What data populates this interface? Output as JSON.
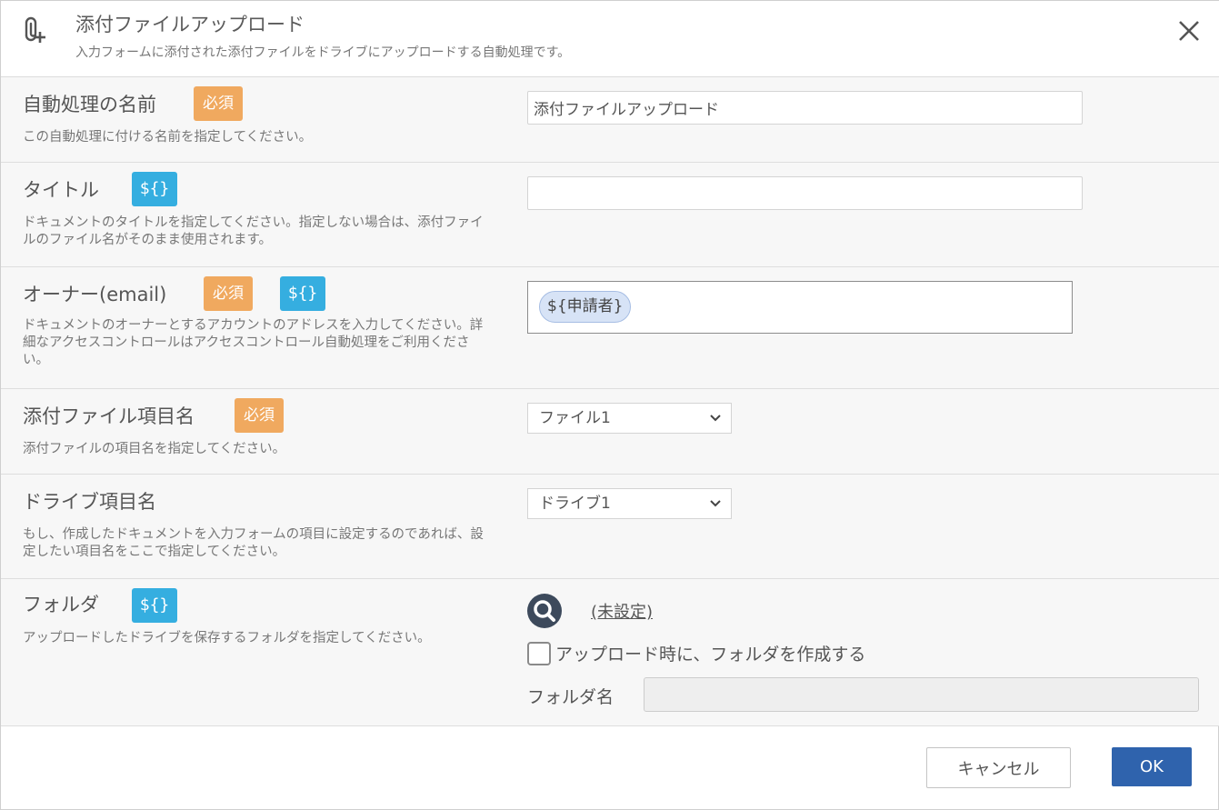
{
  "header": {
    "title": "添付ファイルアップロード",
    "subtitle": "入力フォームに添付された添付ファイルをドライブにアップロードする自動処理です。",
    "icon": "paperclip-plus-icon",
    "close_icon": "close-icon"
  },
  "badges": {
    "required": "必須",
    "variable": "${}"
  },
  "fields": {
    "name": {
      "label": "自動処理の名前",
      "description": "この自動処理に付ける名前を指定してください。",
      "value": "添付ファイルアップロード"
    },
    "title": {
      "label": "タイトル",
      "description": "ドキュメントのタイトルを指定してください。指定しない場合は、添付ファイルのファイル名がそのまま使用されます。",
      "value": ""
    },
    "owner": {
      "label": "オーナー(email)",
      "description": "ドキュメントのオーナーとするアカウントのアドレスを入力してください。詳細なアクセスコントロールはアクセスコントロール自動処理をご利用ください。",
      "chip": "${申請者}"
    },
    "attachment": {
      "label": "添付ファイル項目名",
      "description": "添付ファイルの項目名を指定してください。",
      "selected": "ファイル1"
    },
    "drive": {
      "label": "ドライブ項目名",
      "description": "もし、作成したドキュメントを入力フォームの項目に設定するのであれば、設定したい項目名をここで指定してください。",
      "selected": "ドライブ1"
    },
    "folder": {
      "label": "フォルダ",
      "description": "アップロードしたドライブを保存するフォルダを指定してください。",
      "unset_link": "(未設定)",
      "create_checkbox_label": "アップロード時に、フォルダを作成する",
      "create_checked": false,
      "folder_name_label": "フォルダ名",
      "folder_name_value": ""
    }
  },
  "footer": {
    "cancel_label": "キャンセル",
    "ok_label": "OK"
  },
  "colors": {
    "required_badge": "#f0a95f",
    "variable_badge": "#35aee0",
    "ok_button": "#2f63ad",
    "chip_background": "#d7e3f6"
  }
}
